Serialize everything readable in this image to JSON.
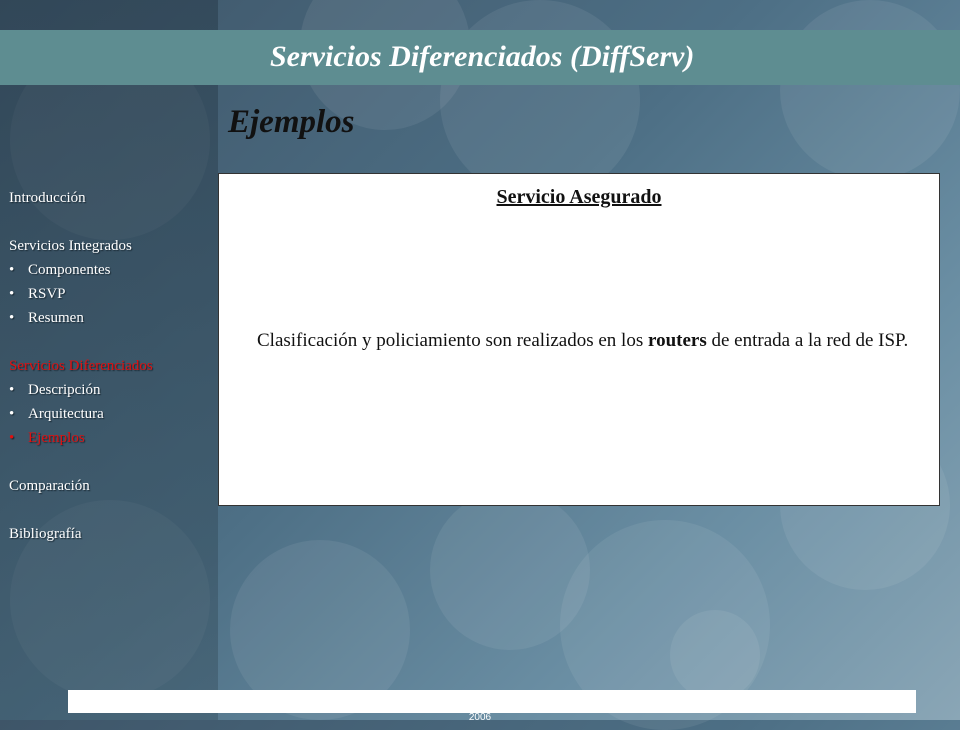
{
  "slide": {
    "title": "Servicios Diferenciados (DiffServ)",
    "subtitle": "Ejemplos"
  },
  "nav": {
    "introduccion": "Introducción",
    "integrados": "Servicios Integrados",
    "integrados_items": [
      "Componentes",
      "RSVP",
      "Resumen"
    ],
    "diferenciados": "Servicios Diferenciados",
    "diferenciados_items": [
      "Descripción",
      "Arquitectura",
      "Ejemplos"
    ],
    "comparacion": "Comparación",
    "bibliografia": "Bibliografía",
    "bullet": "•"
  },
  "content": {
    "heading": "Servicio Asegurado",
    "text_before": "Clasificación y policiamiento son realizados en los ",
    "text_bold": "routers",
    "text_after": " de entrada a la red de ISP."
  },
  "footer": {
    "text": "2006"
  },
  "colors": {
    "title_bar": "#5e8d91",
    "active_nav": "#e01010"
  }
}
